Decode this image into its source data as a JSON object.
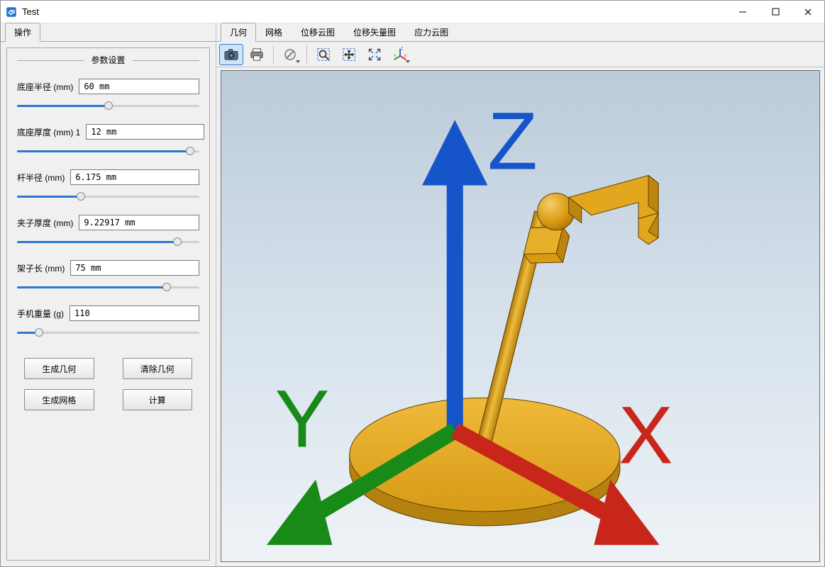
{
  "window": {
    "title": "Test"
  },
  "left": {
    "tab_label": "操作",
    "group_title": "参数设置",
    "params": [
      {
        "label": "底座半径 (mm)",
        "value": "60 mm",
        "fill": 50
      },
      {
        "label": "底座厚度 (mm) 1",
        "value": "12 mm",
        "fill": 95
      },
      {
        "label": "杆半径 (mm)",
        "value": "6.175 mm",
        "fill": 35
      },
      {
        "label": "夹子厚度 (mm)",
        "value": "9.22917 mm",
        "fill": 88
      },
      {
        "label": "架子长 (mm)",
        "value": "75 mm",
        "fill": 82
      },
      {
        "label": "手机重量 (g)",
        "value": "110",
        "fill": 12
      }
    ],
    "buttons": {
      "gen_geom": "生成几何",
      "clear_geom": "清除几何",
      "gen_mesh": "生成网格",
      "compute": "计算"
    }
  },
  "top_tabs": [
    "几何",
    "网格",
    "位移云图",
    "位移矢量图",
    "应力云图"
  ],
  "active_top_tab": 0,
  "triad_labels": {
    "x": "X",
    "y": "Y",
    "z": "Z"
  }
}
